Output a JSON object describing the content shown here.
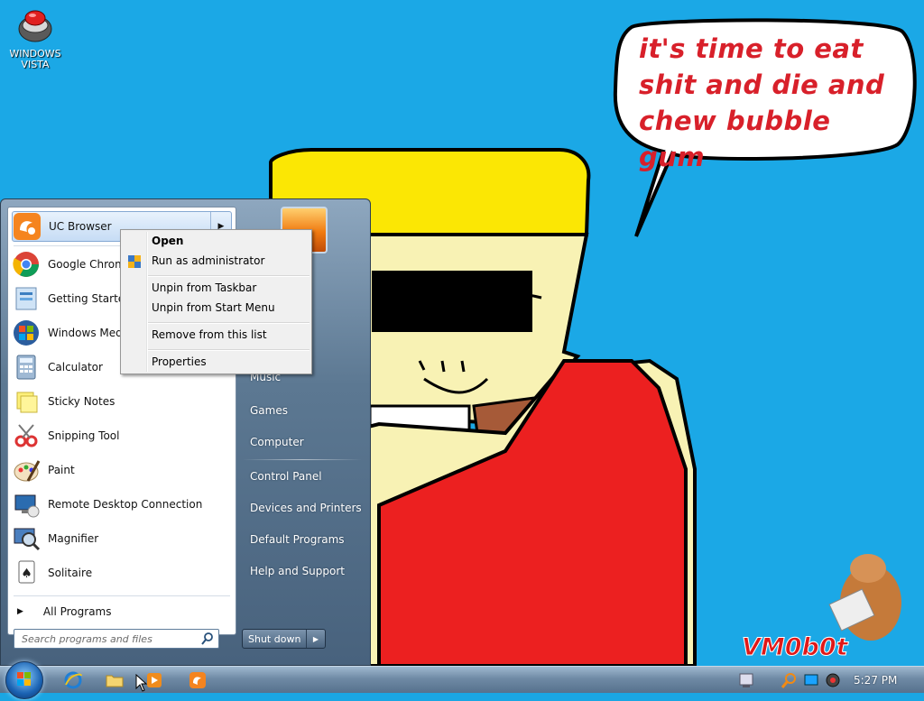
{
  "desktop": {
    "icon_label": "WINDOWS\nVISTA",
    "speech_text": "it's time to eat shit and die and chew bubble gum",
    "watermark": "VM0b0t"
  },
  "start_menu": {
    "programs": [
      {
        "label": "UC Browser",
        "icon": "uc-browser-icon"
      },
      {
        "label": "Google Chrome",
        "icon": "chrome-icon"
      },
      {
        "label": "Getting Started",
        "icon": "getting-started-icon"
      },
      {
        "label": "Windows Media",
        "icon": "windows-media-icon"
      },
      {
        "label": "Calculator",
        "icon": "calculator-icon"
      },
      {
        "label": "Sticky Notes",
        "icon": "sticky-notes-icon"
      },
      {
        "label": "Snipping Tool",
        "icon": "snipping-tool-icon"
      },
      {
        "label": "Paint",
        "icon": "paint-icon"
      },
      {
        "label": "Remote Desktop Connection",
        "icon": "remote-desktop-icon"
      },
      {
        "label": "Magnifier",
        "icon": "magnifier-icon"
      },
      {
        "label": "Solitaire",
        "icon": "solitaire-icon"
      }
    ],
    "all_programs": "All Programs",
    "search_placeholder": "Search programs and files",
    "right_links": [
      "Music",
      "Games",
      "Computer",
      "Control Panel",
      "Devices and Printers",
      "Default Programs",
      "Help and Support"
    ],
    "shutdown_label": "Shut down"
  },
  "context_menu": {
    "open": "Open",
    "run_as_admin": "Run as administrator",
    "unpin_taskbar": "Unpin from Taskbar",
    "unpin_start": "Unpin from Start Menu",
    "remove": "Remove from this list",
    "properties": "Properties"
  },
  "taskbar": {
    "clock": "5:27 PM"
  }
}
